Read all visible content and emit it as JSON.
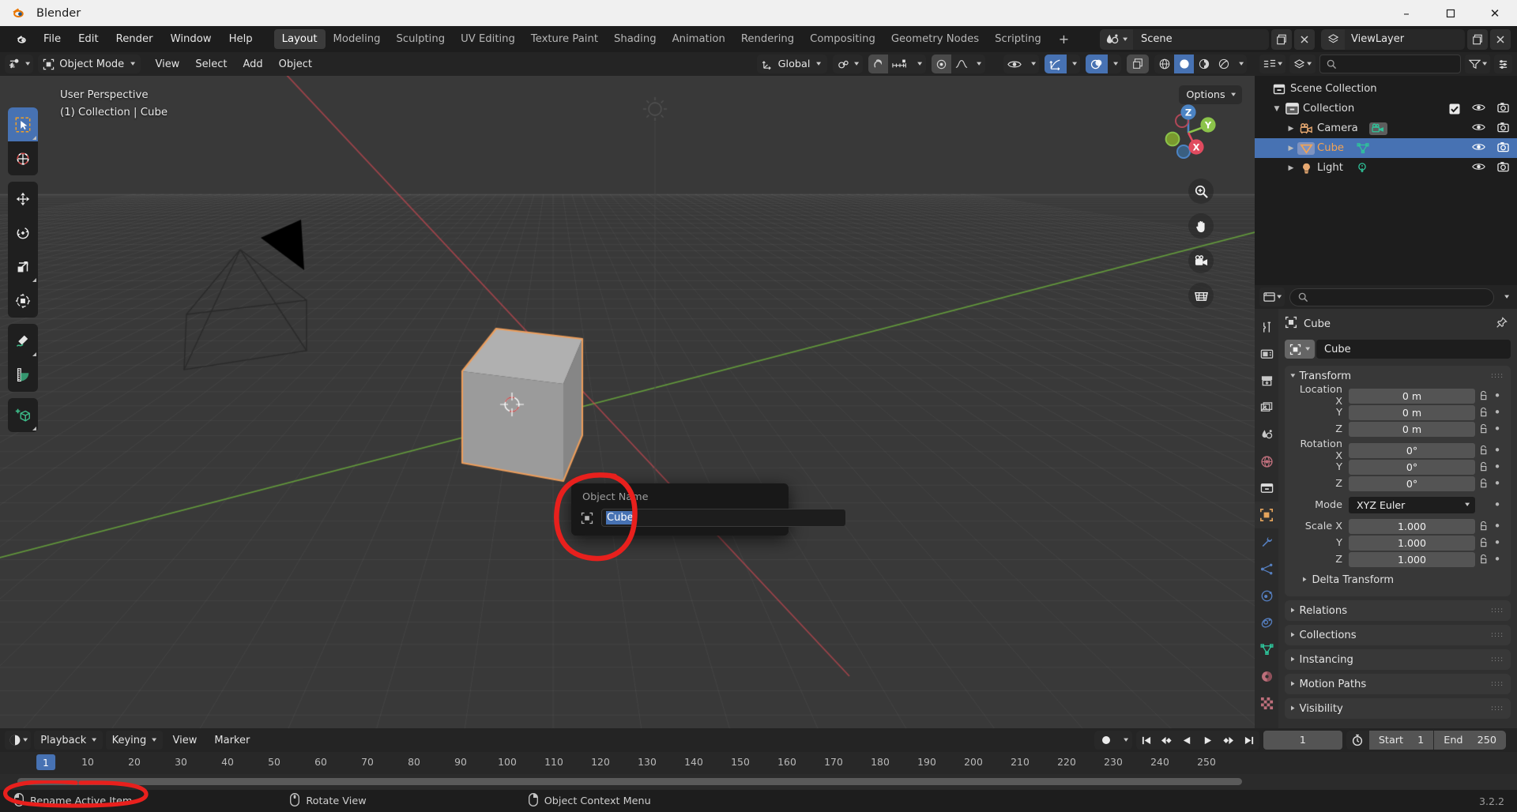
{
  "window": {
    "title": "Blender",
    "app_icon": "blender-logo-icon",
    "minimize": "–",
    "maximize": "☐",
    "close": "✕"
  },
  "topbar": {
    "menus": [
      "File",
      "Edit",
      "Render",
      "Window",
      "Help"
    ],
    "workspaces": [
      {
        "label": "Layout",
        "active": true
      },
      {
        "label": "Modeling",
        "active": false
      },
      {
        "label": "Sculpting",
        "active": false
      },
      {
        "label": "UV Editing",
        "active": false
      },
      {
        "label": "Texture Paint",
        "active": false
      },
      {
        "label": "Shading",
        "active": false
      },
      {
        "label": "Animation",
        "active": false
      },
      {
        "label": "Rendering",
        "active": false
      },
      {
        "label": "Compositing",
        "active": false
      },
      {
        "label": "Geometry Nodes",
        "active": false
      },
      {
        "label": "Scripting",
        "active": false
      }
    ],
    "add_workspace": "+",
    "scene_name": "Scene",
    "view_layer_name": "ViewLayer"
  },
  "viewport_header": {
    "editor_type": "editor-type-3dview-icon",
    "mode": "Object Mode",
    "menus": [
      "View",
      "Select",
      "Add",
      "Object"
    ],
    "transform_orientation": "Global",
    "snap_label": "snap-magnet-icon",
    "proportional_label": "proportional-editing-icon"
  },
  "viewport": {
    "perspective_label": "User Perspective",
    "collection_label": "(1) Collection | Cube",
    "options_label": "Options",
    "gizmo_axes": {
      "x": "X",
      "y": "Y",
      "z": "Z"
    },
    "tools": [
      {
        "name": "tweak-select-box-tool",
        "active": true
      },
      {
        "name": "cursor-tool",
        "active": false
      },
      {
        "name": "move-tool",
        "active": false
      },
      {
        "name": "rotate-tool",
        "active": false
      },
      {
        "name": "scale-tool",
        "active": false
      },
      {
        "name": "transform-tool",
        "active": false
      },
      {
        "name": "annotate-tool",
        "active": false
      },
      {
        "name": "measure-tool",
        "active": false
      },
      {
        "name": "add-cube-tool",
        "active": false
      }
    ],
    "nav_icons": [
      "zoom-icon",
      "pan-hand-icon",
      "camera-view-icon",
      "toggle-perspective-icon"
    ]
  },
  "rename_popup": {
    "title": "Object Name",
    "icon": "object-data-icon",
    "value": "Cube",
    "selected": true
  },
  "outliner": {
    "display_mode": "view-layer-icon",
    "filter_icon": "filter-icon",
    "search_placeholder": "",
    "rows": [
      {
        "label": "Scene Collection",
        "indent": 0,
        "icon": "scene-collection-icon",
        "expand": "",
        "selected": false,
        "checkbox": false,
        "eye": false,
        "camera": false
      },
      {
        "label": "Collection",
        "indent": 1,
        "icon": "collection-icon",
        "expand": "▼",
        "selected": false,
        "checkbox": true,
        "eye": true,
        "camera": true
      },
      {
        "label": "Camera",
        "indent": 2,
        "icon": "camera-object-icon",
        "expand": "▶",
        "selected": false,
        "checkbox": false,
        "eye": true,
        "camera": true,
        "data_icon": "camera-data-icon"
      },
      {
        "label": "Cube",
        "indent": 2,
        "icon": "mesh-object-icon",
        "expand": "▶",
        "selected": true,
        "checkbox": false,
        "eye": true,
        "camera": true,
        "data_icon": "mesh-data-icon"
      },
      {
        "label": "Light",
        "indent": 2,
        "icon": "light-object-icon",
        "expand": "▶",
        "selected": false,
        "checkbox": false,
        "eye": true,
        "camera": true,
        "data_icon": "light-data-icon"
      }
    ]
  },
  "properties": {
    "breadcrumb_icon": "object-properties-icon",
    "breadcrumb_label": "Cube",
    "pin_icon": "pin-icon",
    "id_icon": "object-icon",
    "id_name": "Cube",
    "tabs": [
      {
        "name": "tool-tab",
        "active": false
      },
      {
        "name": "render-tab",
        "active": false
      },
      {
        "name": "output-tab",
        "active": false
      },
      {
        "name": "view-layer-tab",
        "active": false
      },
      {
        "name": "scene-tab",
        "active": false
      },
      {
        "name": "world-tab",
        "active": false
      },
      {
        "name": "collection-tab",
        "active": false
      },
      {
        "name": "object-tab",
        "active": true
      },
      {
        "name": "modifier-tab",
        "active": false
      },
      {
        "name": "particles-tab",
        "active": false
      },
      {
        "name": "physics-tab",
        "active": false
      },
      {
        "name": "constraints-tab",
        "active": false
      },
      {
        "name": "object-data-tab",
        "active": false
      },
      {
        "name": "material-tab",
        "active": false
      },
      {
        "name": "texture-tab",
        "active": false
      }
    ],
    "transform_panel": {
      "title": "Transform",
      "location": {
        "label": "Location X",
        "x": "0 m",
        "y": "0 m",
        "z": "0 m"
      },
      "rotation": {
        "label": "Rotation X",
        "x": "0°",
        "y": "0°",
        "z": "0°"
      },
      "mode": {
        "label": "Mode",
        "value": "XYZ Euler"
      },
      "scale": {
        "label": "Scale X",
        "x": "1.000",
        "y": "1.000",
        "z": "1.000"
      },
      "axis_y": "Y",
      "axis_z": "Z",
      "delta_transform": "Delta Transform"
    },
    "collapsed_panels": [
      "Relations",
      "Collections",
      "Instancing",
      "Motion Paths",
      "Visibility"
    ]
  },
  "timeline": {
    "editor_icon": "timeline-editor-icon",
    "menus": [
      "Playback",
      "Keying",
      "View",
      "Marker"
    ],
    "playback_buttons": [
      "jump-to-start-icon",
      "jump-prev-keyframe-icon",
      "play-reverse-icon",
      "play-icon",
      "jump-next-keyframe-icon",
      "jump-to-end-icon"
    ],
    "auto_key_icon": "record-auto-keying-icon",
    "current_frame": "1",
    "start_label": "Start",
    "start_value": "1",
    "end_label": "End",
    "end_value": "250",
    "ticks": [
      "10",
      "20",
      "30",
      "40",
      "50",
      "60",
      "70",
      "80",
      "90",
      "100",
      "110",
      "120",
      "130",
      "140",
      "150",
      "160",
      "170",
      "180",
      "190",
      "200",
      "210",
      "220",
      "230",
      "240",
      "250"
    ],
    "current_frame_marker": "1"
  },
  "statusbar": {
    "items": [
      {
        "label": "Rename Active Item",
        "icon": "mouse-left-button-icon"
      },
      {
        "label": "Rotate View",
        "icon": "mouse-middle-button-icon"
      },
      {
        "label": "Object Context Menu",
        "icon": "mouse-right-button-icon"
      }
    ],
    "version": "3.2.2"
  },
  "colors": {
    "accent_blue": "#4772b3",
    "viewport_bg": "#393939",
    "panel_bg": "#303030",
    "header_bg": "#242424",
    "window_bg": "#1d1d1d",
    "selected_outline": "#ed9e5c",
    "annotation_red": "#e8201d"
  }
}
